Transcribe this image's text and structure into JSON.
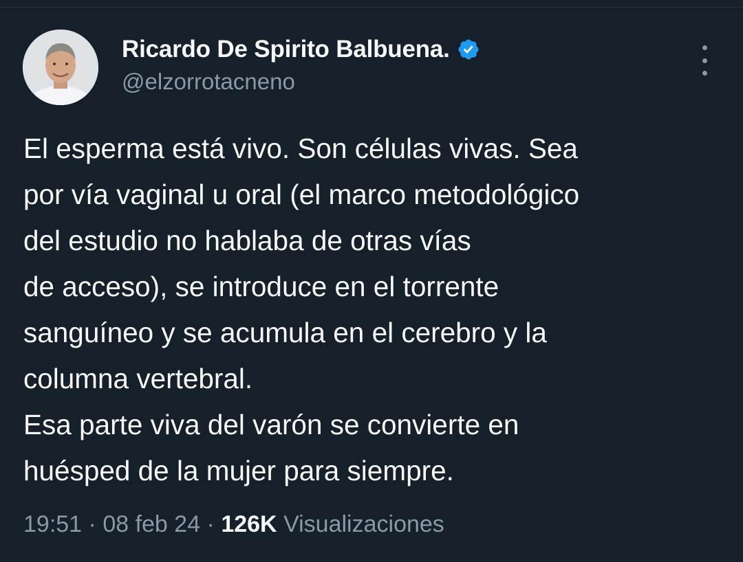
{
  "author": {
    "display_name": "Ricardo De Spirito Balbuena.",
    "handle": "@elzorrotacneno",
    "verified_color": "#1d9bf0"
  },
  "icons": {
    "verified": "verified-badge-icon",
    "more": "more-options-icon"
  },
  "tweet": {
    "lines": [
      "El esperma está vivo. Son células vivas. Sea",
      "por vía vaginal u oral (el marco metodológico",
      "del estudio no hablaba de otras vías",
      "de acceso), se introduce en el torrente",
      "sanguíneo y se acumula en el cerebro y la",
      "columna vertebral.",
      "Esa parte viva del varón se convierte en",
      "huésped de la mujer para siempre."
    ]
  },
  "meta": {
    "time": "19:51",
    "separator": " · ",
    "date": "08 feb 24",
    "views_count": "126K",
    "views_label": "Visualizaciones"
  },
  "colors": {
    "background": "#15202b",
    "text": "#f7f9f9",
    "secondary": "#8b98a5",
    "accent": "#1d9bf0"
  }
}
